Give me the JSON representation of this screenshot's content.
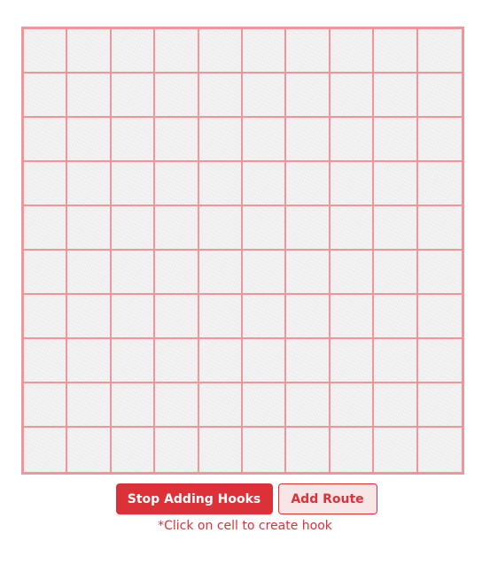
{
  "wall": {
    "rows": 10,
    "columns": 10,
    "grid_color": "#f0959a",
    "background_color": "#f1f1f1"
  },
  "controls": {
    "stop_adding_hooks_label": "Stop Adding Hooks",
    "add_route_label": "Add Route",
    "accent_color": "#dc3139"
  },
  "hint": {
    "text": "*Click on cell to create hook"
  }
}
